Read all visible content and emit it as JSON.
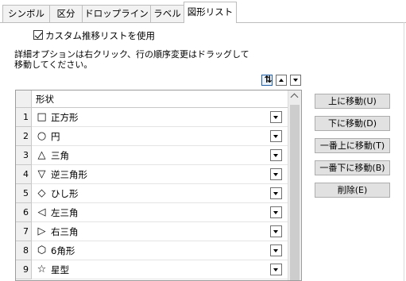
{
  "tabs": [
    {
      "label": "シンボル",
      "active": false
    },
    {
      "label": "区分",
      "active": false
    },
    {
      "label": "ドロップライン",
      "active": false
    },
    {
      "label": "ラベル",
      "active": false
    },
    {
      "label": "図形リスト",
      "active": true
    }
  ],
  "custom_list": {
    "label": "カスタム推移リストを使用",
    "checked": true
  },
  "description": {
    "line1": "詳細オプションは右クリック、行の順序変更はドラッグして",
    "line2": "移動してください。"
  },
  "list_controls": {
    "sort_icon": "sort-icon",
    "up_icon": "triangle-up-icon",
    "down_icon": "triangle-down-icon"
  },
  "grid": {
    "header": "形状",
    "rows": [
      {
        "num": "1",
        "icon": "□",
        "label": "正方形"
      },
      {
        "num": "2",
        "icon": "○",
        "label": "円"
      },
      {
        "num": "3",
        "icon": "△",
        "label": "三角"
      },
      {
        "num": "4",
        "icon": "▽",
        "label": "逆三角形"
      },
      {
        "num": "5",
        "icon": "◇",
        "label": "ひし形"
      },
      {
        "num": "6",
        "icon": "◁",
        "label": "左三角"
      },
      {
        "num": "7",
        "icon": "▷",
        "label": "右三角"
      },
      {
        "num": "8",
        "icon": "⬡",
        "label": "6角形"
      },
      {
        "num": "9",
        "icon": "☆",
        "label": "星型"
      }
    ]
  },
  "buttons": {
    "move_up": "上に移動(U)",
    "move_down": "下に移動(D)",
    "move_top": "一番上に移動(T)",
    "move_bottom": "一番下に移動(B)",
    "delete": "削除(E)"
  },
  "colors": {
    "tab_border": "#bdbdbd",
    "button_face": "#e1e1e1",
    "header_face": "#f0f0f0"
  }
}
